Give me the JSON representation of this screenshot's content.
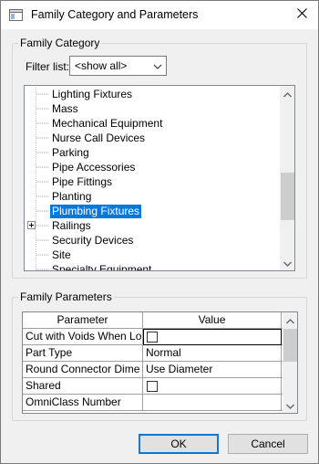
{
  "window": {
    "title": "Family Category and Parameters",
    "close_icon": "close-icon"
  },
  "family_category": {
    "group_label": "Family Category",
    "filter_label": "Filter list:",
    "filter_value": "<show all>",
    "items": [
      {
        "label": "Lighting Fixtures",
        "selected": false,
        "expandable": false
      },
      {
        "label": "Mass",
        "selected": false,
        "expandable": false
      },
      {
        "label": "Mechanical Equipment",
        "selected": false,
        "expandable": false
      },
      {
        "label": "Nurse Call Devices",
        "selected": false,
        "expandable": false
      },
      {
        "label": "Parking",
        "selected": false,
        "expandable": false
      },
      {
        "label": "Pipe Accessories",
        "selected": false,
        "expandable": false
      },
      {
        "label": "Pipe Fittings",
        "selected": false,
        "expandable": false
      },
      {
        "label": "Planting",
        "selected": false,
        "expandable": false
      },
      {
        "label": "Plumbing Fixtures",
        "selected": true,
        "expandable": false
      },
      {
        "label": "Railings",
        "selected": false,
        "expandable": true
      },
      {
        "label": "Security Devices",
        "selected": false,
        "expandable": false
      },
      {
        "label": "Site",
        "selected": false,
        "expandable": false
      },
      {
        "label": "Specialty Equipment",
        "selected": false,
        "expandable": false
      }
    ]
  },
  "family_parameters": {
    "group_label": "Family Parameters",
    "columns": [
      "Parameter",
      "Value"
    ],
    "rows": [
      {
        "name": "Cut with Voids When Lo",
        "value": "",
        "type": "checkbox",
        "checked": false,
        "active": true
      },
      {
        "name": "Part Type",
        "value": "Normal",
        "type": "text",
        "active": false
      },
      {
        "name": "Round Connector Dime",
        "value": "Use Diameter",
        "type": "text",
        "active": false
      },
      {
        "name": "Shared",
        "value": "",
        "type": "checkbox",
        "checked": false,
        "active": false
      },
      {
        "name": "OmniClass Number",
        "value": "",
        "type": "text",
        "active": false
      }
    ]
  },
  "buttons": {
    "ok": "OK",
    "cancel": "Cancel"
  },
  "colors": {
    "selection": "#0078d7",
    "dialog_bg": "#f0f0f0"
  }
}
